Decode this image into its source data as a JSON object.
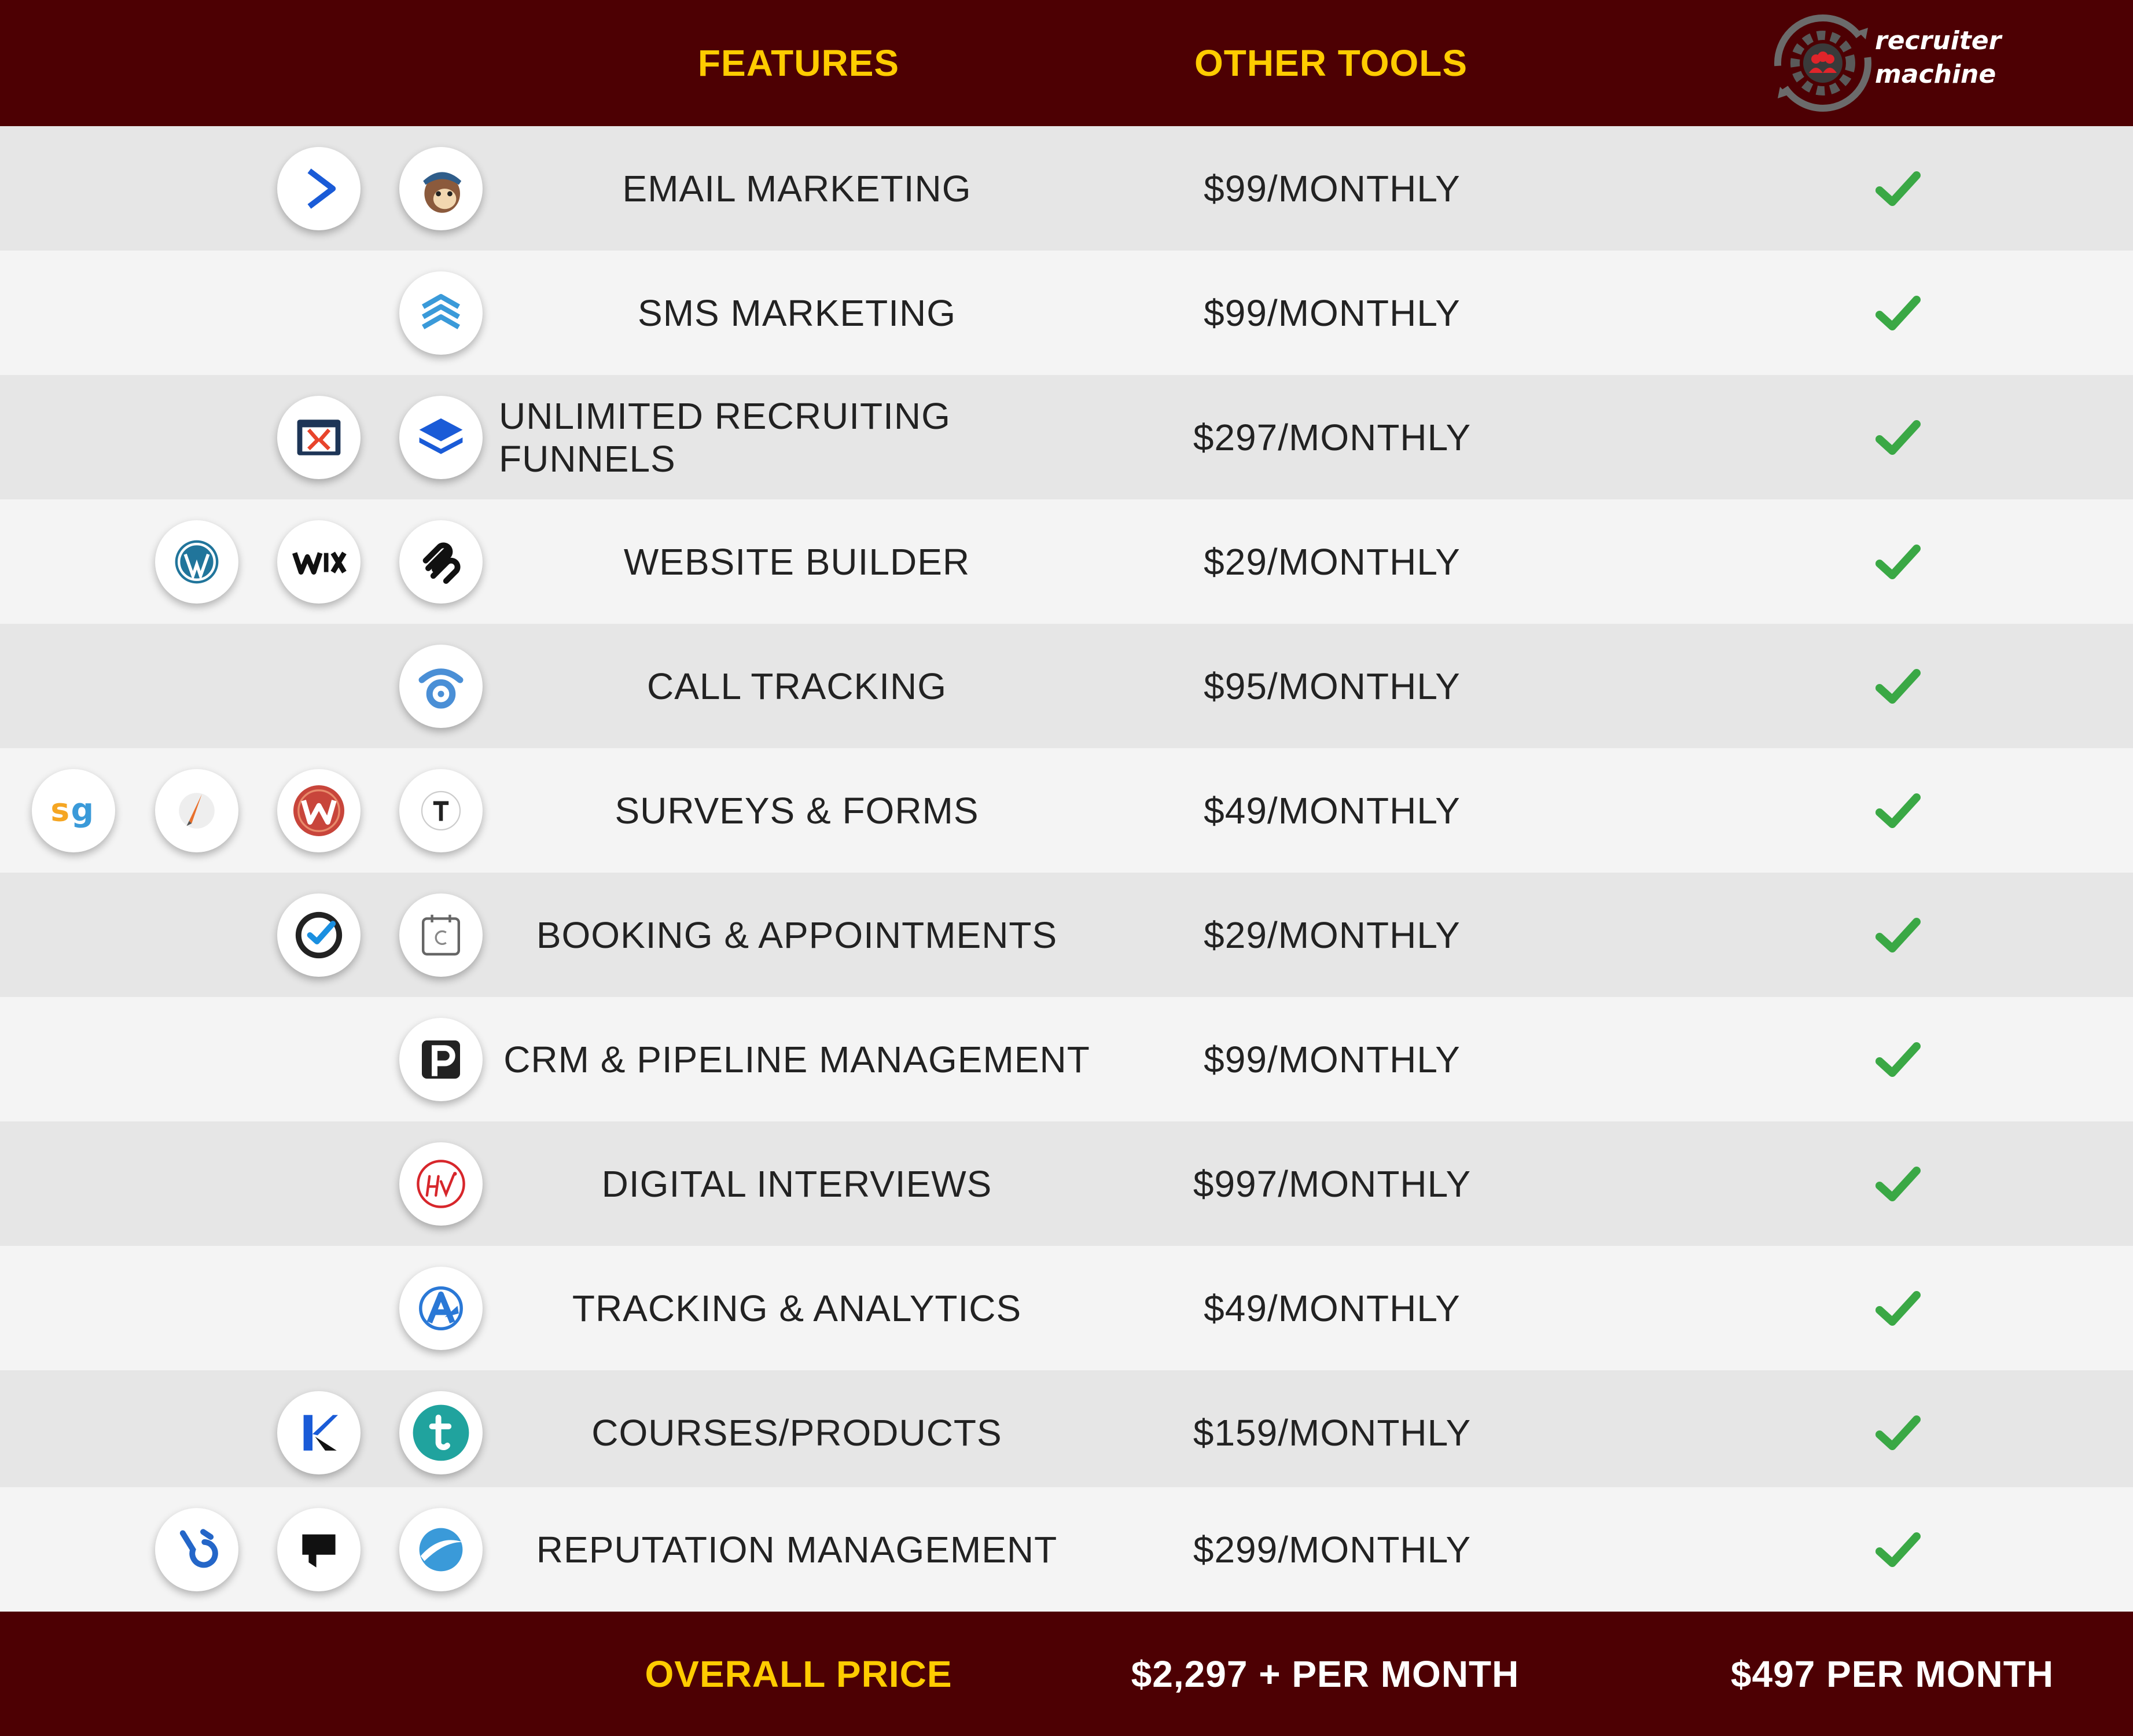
{
  "header": {
    "features": "FEATURES",
    "other_tools": "OTHER TOOLS",
    "brand_line1": "recruiter",
    "brand_line2": "machine"
  },
  "rows": [
    {
      "feature": "EMAIL MARKETING",
      "price": "$99/MONTHLY",
      "icons": [
        "activecampaign-icon",
        "mailchimp-icon"
      ]
    },
    {
      "feature": "SMS MARKETING",
      "price": "$99/MONTHLY",
      "icons": [
        "stacked-chevrons-icon"
      ]
    },
    {
      "feature": "UNLIMITED RECRUITING FUNNELS",
      "price": "$297/MONTHLY",
      "icons": [
        "clickfunnels-icon",
        "layers-icon"
      ]
    },
    {
      "feature": "WEBSITE BUILDER",
      "price": "$29/MONTHLY",
      "icons": [
        "wordpress-icon",
        "wix-icon",
        "squarespace-icon"
      ]
    },
    {
      "feature": "CALL TRACKING",
      "price": "$95/MONTHLY",
      "icons": [
        "callrail-icon"
      ]
    },
    {
      "feature": "SURVEYS & FORMS",
      "price": "$49/MONTHLY",
      "icons": [
        "surveygizmo-icon",
        "pen-icon",
        "wufoo-icon",
        "typeform-icon"
      ]
    },
    {
      "feature": "BOOKING & APPOINTMENTS",
      "price": "$29/MONTHLY",
      "icons": [
        "clock-check-icon",
        "calendar-icon"
      ]
    },
    {
      "feature": "CRM & PIPELINE MANAGEMENT",
      "price": "$99/MONTHLY",
      "icons": [
        "pipedrive-icon"
      ]
    },
    {
      "feature": "DIGITAL INTERVIEWS",
      "price": "$997/MONTHLY",
      "icons": [
        "hirevue-icon"
      ]
    },
    {
      "feature": "TRACKING & ANALYTICS",
      "price": "$49/MONTHLY",
      "icons": [
        "analytics-icon"
      ]
    },
    {
      "feature": "COURSES/PRODUCTS",
      "price": "$159/MONTHLY",
      "icons": [
        "kajabi-icon",
        "teachable-icon"
      ]
    },
    {
      "feature": "REPUTATION MANAGEMENT",
      "price": "$299/MONTHLY",
      "icons": [
        "birdeye-icon",
        "podium-icon",
        "swirl-icon"
      ]
    }
  ],
  "footer": {
    "overall_price": "OVERALL PRICE",
    "other_total": "$2,297 + PER MONTH",
    "our_total": "$497 PER MONTH"
  },
  "colors": {
    "bar_bg": "#4d0003",
    "header_text": "#ffcc00",
    "check": "#3aa845",
    "row_dark": "#e6e6e6",
    "row_light": "#f4f4f4"
  }
}
